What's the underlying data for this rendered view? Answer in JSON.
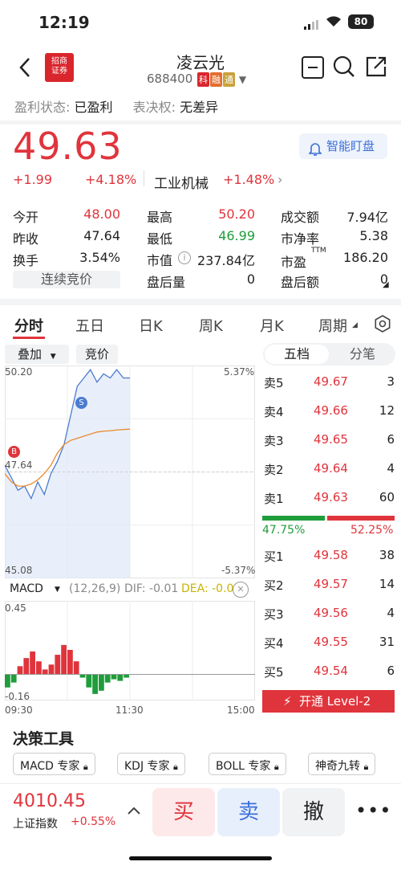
{
  "status": {
    "time": "12:19",
    "battery": "80"
  },
  "header": {
    "title": "凌云光",
    "code": "688400",
    "tags": [
      "科",
      "融",
      "通"
    ],
    "broker_logo_text": [
      "招商",
      "证券"
    ]
  },
  "info": {
    "profit_label": "盈利状态:",
    "profit_value": "已盈利",
    "vote_label": "表决权:",
    "vote_value": "无差异"
  },
  "price": {
    "last": "49.63",
    "change": "+1.99",
    "change_pct": "+4.18%",
    "industry": "工业机械",
    "industry_pct": "+1.48%",
    "watch_button": "智能盯盘"
  },
  "quote": {
    "col1": [
      [
        "今开",
        "48.00"
      ],
      [
        "昨收",
        "47.64"
      ],
      [
        "换手",
        "3.54%"
      ]
    ],
    "col2": [
      [
        "最高",
        "50.20"
      ],
      [
        "最低",
        "46.99"
      ],
      [
        "市值",
        "237.84亿"
      ],
      [
        "盘后量",
        "0"
      ]
    ],
    "col3": [
      [
        "成交额",
        "7.94亿"
      ],
      [
        "市净率",
        "5.38"
      ],
      [
        "市盈",
        "186.20"
      ],
      [
        "盘后额",
        "0"
      ]
    ],
    "ttm": "TTM",
    "auction": "连续竞价"
  },
  "tabs": [
    "分时",
    "五日",
    "日K",
    "周K",
    "月K",
    "周期"
  ],
  "chart_controls": {
    "overlay": "叠加",
    "bid": "竞价"
  },
  "chart_labels": {
    "high_price": "50.20",
    "high_pct": "5.37%",
    "mid_price": "47.64",
    "low_price": "45.08",
    "low_pct": "-5.37%",
    "start_time": "09:30",
    "mid_time": "11:30",
    "end_time": "15:00",
    "buy_marker": "B",
    "sell_marker": "S"
  },
  "macd": {
    "label": "MACD",
    "params": "(12,26,9)",
    "dif": "DIF: -0.01",
    "dea": "DEA: -0.00",
    "top": "0.45",
    "bottom": "-0.16"
  },
  "orderbook": {
    "tabs": [
      "五档",
      "分笔"
    ],
    "asks": [
      [
        "卖5",
        "49.67",
        "3"
      ],
      [
        "卖4",
        "49.66",
        "12"
      ],
      [
        "卖3",
        "49.65",
        "6"
      ],
      [
        "卖2",
        "49.64",
        "4"
      ],
      [
        "卖1",
        "49.63",
        "60"
      ]
    ],
    "bids": [
      [
        "买1",
        "49.58",
        "38"
      ],
      [
        "买2",
        "49.57",
        "14"
      ],
      [
        "买3",
        "49.56",
        "4"
      ],
      [
        "买4",
        "49.55",
        "31"
      ],
      [
        "买5",
        "49.54",
        "6"
      ]
    ],
    "buy_ratio": "47.75%",
    "sell_ratio": "52.25%",
    "level2": "开通 Level-2"
  },
  "tools": {
    "title": "决策工具",
    "items": [
      "MACD 专家",
      "KDJ 专家",
      "BOLL 专家",
      "神奇九转"
    ]
  },
  "bottom": {
    "index_value": "4010.45",
    "index_name": "上证指数",
    "index_pct": "+0.55%",
    "buy": "买",
    "sell": "卖",
    "cancel": "撤"
  },
  "chart_data": [
    {
      "type": "line",
      "title": "分时",
      "ylim": [
        45.08,
        50.2
      ],
      "y_pct_labels": [
        "5.37%",
        "-5.37%"
      ],
      "x_ticks": [
        "09:30",
        "11:30",
        "15:00"
      ],
      "series": [
        {
          "values": [
            47.8,
            47.5,
            47.2,
            47.3,
            47.0,
            47.4,
            47.1,
            47.6,
            47.9,
            48.3,
            49.0,
            49.7,
            49.9,
            50.1,
            49.8,
            50.0,
            49.9,
            50.1,
            49.9,
            49.9
          ]
        },
        {
          "values": [
            47.6,
            47.4,
            47.3,
            47.3,
            47.35,
            47.45,
            47.6,
            47.8,
            48.1,
            48.3,
            48.4,
            48.45,
            48.5,
            48.55,
            48.6,
            48.62,
            48.63,
            48.65,
            48.66,
            48.67
          ]
        }
      ]
    },
    {
      "type": "bar",
      "title": "MACD",
      "ylim": [
        -0.16,
        0.45
      ],
      "values": [
        -0.08,
        -0.05,
        0.05,
        0.1,
        0.14,
        0.08,
        0.03,
        0.06,
        0.12,
        0.18,
        0.15,
        0.08,
        -0.02,
        -0.08,
        -0.12,
        -0.1,
        -0.05,
        -0.03,
        -0.04,
        -0.02
      ]
    }
  ]
}
